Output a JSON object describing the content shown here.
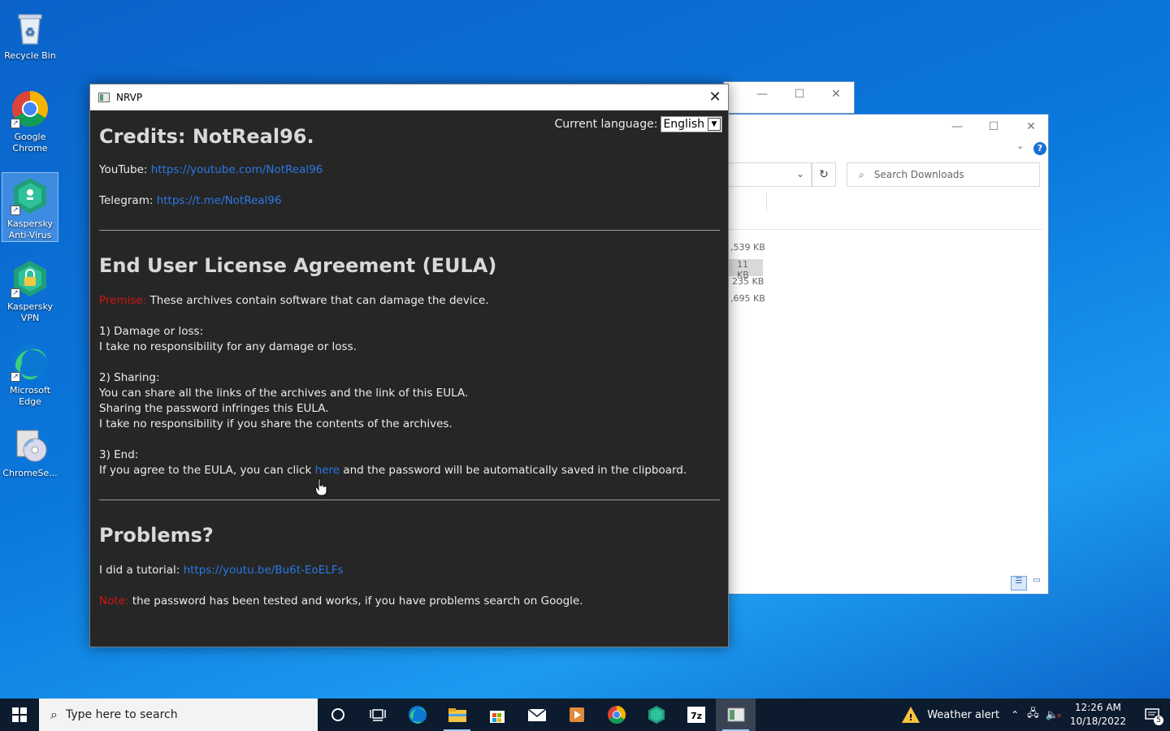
{
  "desktop": {
    "icons": [
      {
        "label": "Recycle Bin"
      },
      {
        "label": "Google Chrome"
      },
      {
        "label": "Kaspersky Anti-Virus"
      },
      {
        "label": "Kaspersky VPN"
      },
      {
        "label": "Microsoft Edge"
      },
      {
        "label": "ChromeSe..."
      }
    ]
  },
  "explorer": {
    "search_placeholder": "Search Downloads",
    "file_sizes": [
      ",539 KB",
      "11 KB",
      "235 KB",
      ",695 KB"
    ]
  },
  "nrvp": {
    "title": "NRVP",
    "language_label": "Current language:",
    "language_value": "English",
    "credits_title": "Credits: NotReal96.",
    "youtube_label": "YouTube:",
    "youtube_link": "https://youtube.com/NotReal96",
    "telegram_label": "Telegram:",
    "telegram_link": "https://t.me/NotReal96",
    "eula_title": "End User License Agreement (EULA)",
    "premise_label": "Premise:",
    "premise_text": "These archives contain software that can damage the device.",
    "s1_title": "1) Damage or loss:",
    "s1_text": "I take no responsibility for any damage or loss.",
    "s2_title": "2) Sharing:",
    "s2_line1": "You can share all the links of the archives and the link of this EULA.",
    "s2_line2": "Sharing the password infringes this EULA.",
    "s2_line3": "I take no responsibility if you share the contents of the archives.",
    "s3_title": "3) End:",
    "s3_pre": "If you agree to the EULA, you can click",
    "s3_link": "here",
    "s3_post": "and the password will be automatically saved in the clipboard.",
    "problems_title": "Problems?",
    "tutorial_label": "I did a tutorial:",
    "tutorial_link": "https://youtu.be/Bu6t-EoELFs",
    "note_label": "Note:",
    "note_text": "the password has been tested and works, if you have problems search on Google."
  },
  "taskbar": {
    "search_placeholder": "Type here to search",
    "weather_label": "Weather alert",
    "time": "12:26 AM",
    "date": "10/18/2022",
    "notification_count": "5"
  }
}
